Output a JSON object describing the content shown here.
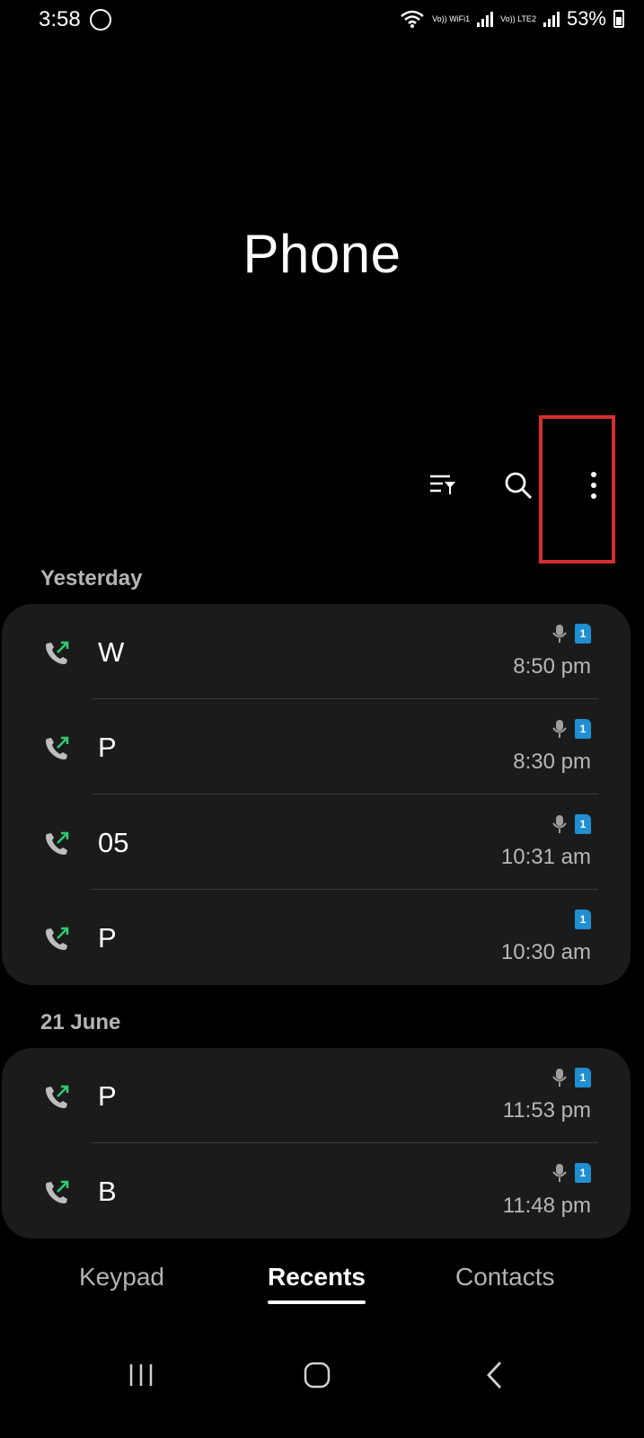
{
  "status": {
    "time": "3:58",
    "battery": "53%",
    "sim1_label": "Vo)) WiFi1",
    "sim2_label": "Vo)) LTE2"
  },
  "app": {
    "title": "Phone"
  },
  "toolbar": {
    "filter_icon": "filter-list-icon",
    "search_icon": "search-icon",
    "more_icon": "more-vert-icon"
  },
  "sections": [
    {
      "header": "Yesterday",
      "calls": [
        {
          "name": "W",
          "time": "8:50 pm",
          "mic": true,
          "sim": "1"
        },
        {
          "name": "P",
          "time": "8:30 pm",
          "mic": true,
          "sim": "1"
        },
        {
          "name": "05",
          "time": "10:31 am",
          "mic": true,
          "sim": "1"
        },
        {
          "name": "P",
          "time": "10:30 am",
          "mic": false,
          "sim": "1"
        }
      ]
    },
    {
      "header": "21 June",
      "calls": [
        {
          "name": "P",
          "time": "11:53 pm",
          "mic": true,
          "sim": "1"
        },
        {
          "name": "B",
          "time": "11:48 pm",
          "mic": true,
          "sim": "1"
        }
      ]
    }
  ],
  "tabs": {
    "keypad": "Keypad",
    "recents": "Recents",
    "contacts": "Contacts",
    "active": "Recents"
  },
  "colors": {
    "accent": "#1f8fd1",
    "outgoing": "#2ecc71",
    "highlight": "#d32f2f"
  }
}
